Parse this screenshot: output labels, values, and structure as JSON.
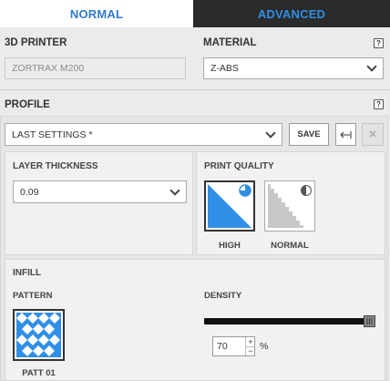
{
  "tabs": {
    "normal": "NORMAL",
    "advanced": "ADVANCED"
  },
  "printer": {
    "label": "3D PRINTER",
    "value": "ZORTRAX M200"
  },
  "material": {
    "label": "MATERIAL",
    "value": "Z-ABS",
    "help": "?"
  },
  "profile": {
    "label": "PROFILE",
    "help": "?",
    "selected": "LAST SETTINGS *",
    "save_label": "SAVE",
    "close_glyph": "✕"
  },
  "layer_thickness": {
    "label": "LAYER THICKNESS",
    "value": "0.09"
  },
  "print_quality": {
    "label": "PRINT QUALITY",
    "options": [
      {
        "label": "HIGH",
        "selected": true
      },
      {
        "label": "NORMAL",
        "selected": false
      }
    ]
  },
  "infill": {
    "label": "INFILL",
    "pattern_label": "PATTERN",
    "pattern_name": "PATT 01",
    "density_label": "DENSITY",
    "density_value": "70",
    "density_unit": "%",
    "density_fraction": 1.0,
    "step_up": "+",
    "step_down": "−"
  },
  "colors": {
    "accent": "#2f8fe6",
    "tab_dark": "#2b2b2b"
  }
}
